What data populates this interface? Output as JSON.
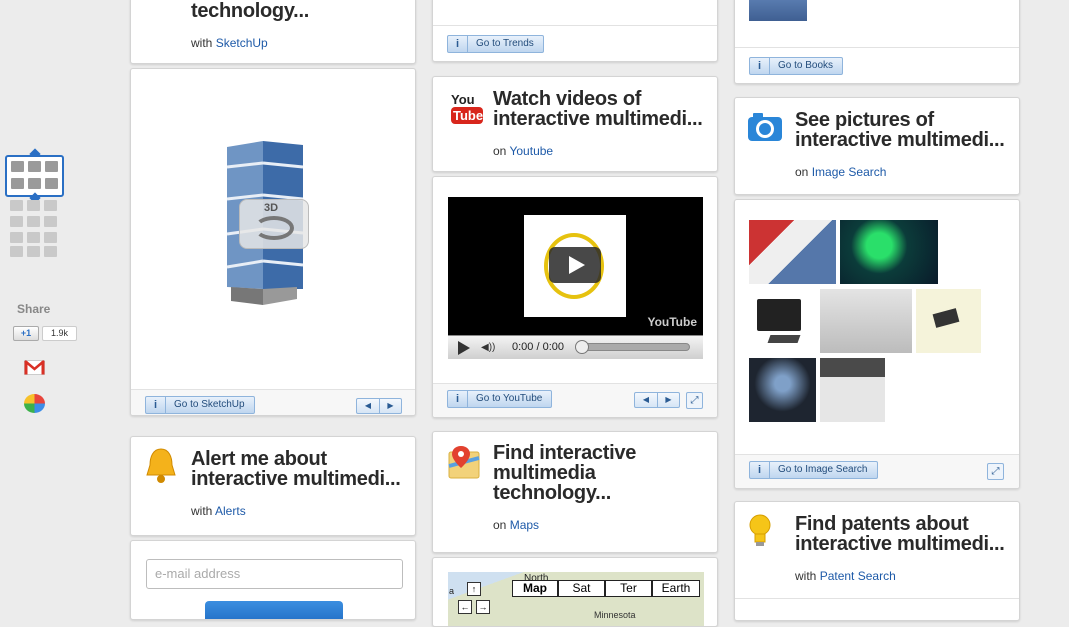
{
  "share": {
    "label": "Share",
    "plusone": "+1",
    "count": "1.9k"
  },
  "sketchup": {
    "title": "technology...",
    "via_prefix": "with",
    "via_link": "SketchUp",
    "button": "Go to SketchUp",
    "model_badge": "3D"
  },
  "trends": {
    "button": "Go to Trends"
  },
  "books": {
    "button": "Go to Books"
  },
  "youtube": {
    "icon_text_top": "You",
    "icon_text_bottom": "Tube",
    "title_line1": "Watch videos of",
    "title_line2": "interactive multimedi...",
    "via_prefix": "on",
    "via_link": "Youtube",
    "time": "0:00 / 0:00",
    "watermark": "YouTube",
    "button": "Go to YouTube"
  },
  "images": {
    "title_line1": "See pictures of",
    "title_line2": "interactive multimedi...",
    "via_prefix": "on",
    "via_link": "Image Search",
    "button": "Go to Image Search"
  },
  "alerts": {
    "title_line1": "Alert me about",
    "title_line2": "interactive multimedi...",
    "via_prefix": "with",
    "via_link": "Alerts",
    "email_placeholder": "e-mail address"
  },
  "maps": {
    "title_line1": "Find interactive",
    "title_line2": "multimedia",
    "title_line3": "technology...",
    "via_prefix": "on",
    "via_link": "Maps",
    "map_types": [
      "Map",
      "Sat",
      "Ter",
      "Earth"
    ],
    "map_label_north": "North",
    "map_label_minnesota": "Minnesota",
    "map_label_a": "a"
  },
  "patents": {
    "title_line1": "Find patents about",
    "title_line2": "interactive multimedi...",
    "via_prefix": "with",
    "via_link": "Patent Search"
  },
  "colors": {
    "accent": "#2a6fc4",
    "link": "#1e5aa8",
    "bg": "#ececec"
  }
}
